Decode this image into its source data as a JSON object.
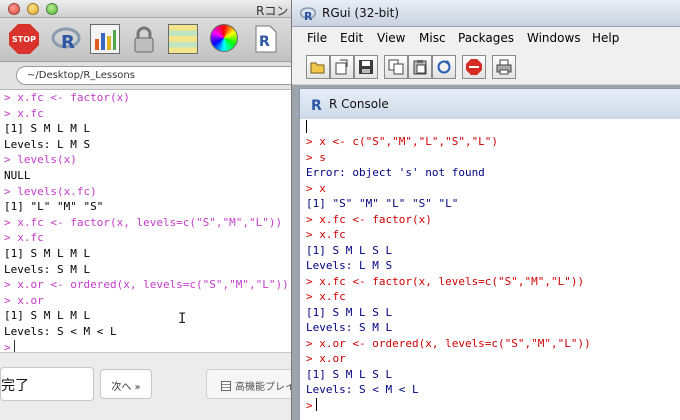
{
  "mac_window": {
    "title": "Rコン",
    "toolbar": {
      "stop_label": "STOP"
    },
    "path": "~/Desktop/R_Lessons",
    "console_lines": [
      {
        "kind": "in",
        "text": "> x.fc <- factor(x)"
      },
      {
        "kind": "in",
        "text": "> x.fc"
      },
      {
        "kind": "out",
        "text": "[1] S M L M L"
      },
      {
        "kind": "out",
        "text": "Levels: L M S"
      },
      {
        "kind": "in",
        "text": "> levels(x)"
      },
      {
        "kind": "out",
        "text": "NULL"
      },
      {
        "kind": "in",
        "text": "> levels(x.fc)"
      },
      {
        "kind": "out",
        "text": "[1] \"L\" \"M\" \"S\""
      },
      {
        "kind": "in",
        "text": "> x.fc <- factor(x, levels=c(\"S\",\"M\",\"L\"))"
      },
      {
        "kind": "in",
        "text": "> x.fc"
      },
      {
        "kind": "out",
        "text": "[1] S M L M L"
      },
      {
        "kind": "out",
        "text": "Levels: S M L"
      },
      {
        "kind": "in",
        "text": "> x.or <- ordered(x, levels=c(\"S\",\"M\",\"L\"))"
      },
      {
        "kind": "in",
        "text": "> x.or"
      },
      {
        "kind": "out",
        "text": "[1] S M L M L"
      },
      {
        "kind": "out",
        "text": "Levels: S < M < L"
      }
    ],
    "prompt": ">",
    "bottom": {
      "done_label": "完了",
      "next_label": "次へ »",
      "hq_label": "高機能プレイ"
    }
  },
  "rgui": {
    "title": "RGui (32-bit)",
    "menu": [
      "File",
      "Edit",
      "View",
      "Misc",
      "Packages",
      "Windows",
      "Help"
    ],
    "toolbar_icons": [
      "open-script-icon",
      "load-workspace-icon",
      "save-workspace-icon",
      "copy-icon",
      "copy-paste-icon",
      "refresh-icon",
      "stop-icon",
      "print-icon"
    ],
    "console": {
      "title": "R Console",
      "lines": [
        {
          "kind": "in",
          "text": "> x <- c(\"S\",\"M\",\"L\",\"S\",\"L\")"
        },
        {
          "kind": "in",
          "text": "> s"
        },
        {
          "kind": "out",
          "text": "Error: object 's' not found"
        },
        {
          "kind": "in",
          "text": "> x"
        },
        {
          "kind": "out",
          "text": "[1] \"S\" \"M\" \"L\" \"S\" \"L\""
        },
        {
          "kind": "in",
          "text": "> x.fc <- factor(x)"
        },
        {
          "kind": "in",
          "text": "> x.fc"
        },
        {
          "kind": "out",
          "text": "[1] S M L S L"
        },
        {
          "kind": "out",
          "text": "Levels: L M S"
        },
        {
          "kind": "in",
          "text": "> x.fc <- factor(x, levels=c(\"S\",\"M\",\"L\"))"
        },
        {
          "kind": "in",
          "text": "> x.fc"
        },
        {
          "kind": "out",
          "text": "[1] S M L S L"
        },
        {
          "kind": "out",
          "text": "Levels: S M L"
        },
        {
          "kind": "in",
          "text": "> x.or <- ordered(x, levels=c(\"S\",\"M\",\"L\"))"
        },
        {
          "kind": "in",
          "text": "> x.or"
        },
        {
          "kind": "out",
          "text": "[1] S M L S L"
        },
        {
          "kind": "out",
          "text": "Levels: S < M < L"
        }
      ],
      "prompt": ">"
    }
  },
  "colors": {
    "mac_input": "#c43cc9",
    "rgui_input": "#d00000",
    "rgui_output": "#000080"
  }
}
